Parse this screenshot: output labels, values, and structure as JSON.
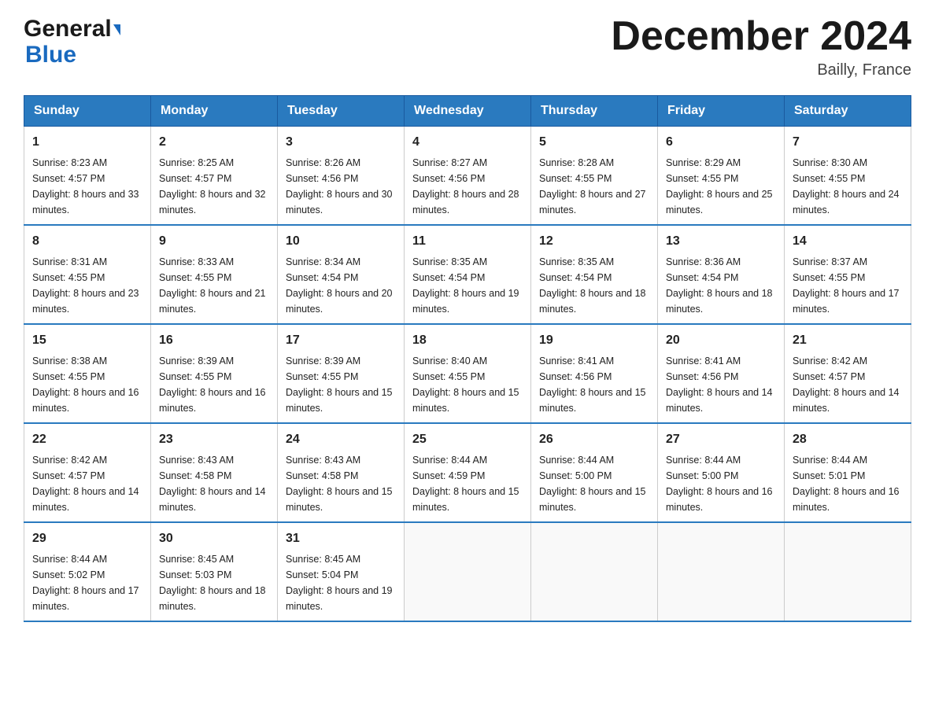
{
  "header": {
    "logo_general": "General",
    "logo_blue": "Blue",
    "month_title": "December 2024",
    "location": "Bailly, France"
  },
  "days_of_week": [
    "Sunday",
    "Monday",
    "Tuesday",
    "Wednesday",
    "Thursday",
    "Friday",
    "Saturday"
  ],
  "weeks": [
    [
      {
        "day": "1",
        "sunrise": "8:23 AM",
        "sunset": "4:57 PM",
        "daylight": "8 hours and 33 minutes."
      },
      {
        "day": "2",
        "sunrise": "8:25 AM",
        "sunset": "4:57 PM",
        "daylight": "8 hours and 32 minutes."
      },
      {
        "day": "3",
        "sunrise": "8:26 AM",
        "sunset": "4:56 PM",
        "daylight": "8 hours and 30 minutes."
      },
      {
        "day": "4",
        "sunrise": "8:27 AM",
        "sunset": "4:56 PM",
        "daylight": "8 hours and 28 minutes."
      },
      {
        "day": "5",
        "sunrise": "8:28 AM",
        "sunset": "4:55 PM",
        "daylight": "8 hours and 27 minutes."
      },
      {
        "day": "6",
        "sunrise": "8:29 AM",
        "sunset": "4:55 PM",
        "daylight": "8 hours and 25 minutes."
      },
      {
        "day": "7",
        "sunrise": "8:30 AM",
        "sunset": "4:55 PM",
        "daylight": "8 hours and 24 minutes."
      }
    ],
    [
      {
        "day": "8",
        "sunrise": "8:31 AM",
        "sunset": "4:55 PM",
        "daylight": "8 hours and 23 minutes."
      },
      {
        "day": "9",
        "sunrise": "8:33 AM",
        "sunset": "4:55 PM",
        "daylight": "8 hours and 21 minutes."
      },
      {
        "day": "10",
        "sunrise": "8:34 AM",
        "sunset": "4:54 PM",
        "daylight": "8 hours and 20 minutes."
      },
      {
        "day": "11",
        "sunrise": "8:35 AM",
        "sunset": "4:54 PM",
        "daylight": "8 hours and 19 minutes."
      },
      {
        "day": "12",
        "sunrise": "8:35 AM",
        "sunset": "4:54 PM",
        "daylight": "8 hours and 18 minutes."
      },
      {
        "day": "13",
        "sunrise": "8:36 AM",
        "sunset": "4:54 PM",
        "daylight": "8 hours and 18 minutes."
      },
      {
        "day": "14",
        "sunrise": "8:37 AM",
        "sunset": "4:55 PM",
        "daylight": "8 hours and 17 minutes."
      }
    ],
    [
      {
        "day": "15",
        "sunrise": "8:38 AM",
        "sunset": "4:55 PM",
        "daylight": "8 hours and 16 minutes."
      },
      {
        "day": "16",
        "sunrise": "8:39 AM",
        "sunset": "4:55 PM",
        "daylight": "8 hours and 16 minutes."
      },
      {
        "day": "17",
        "sunrise": "8:39 AM",
        "sunset": "4:55 PM",
        "daylight": "8 hours and 15 minutes."
      },
      {
        "day": "18",
        "sunrise": "8:40 AM",
        "sunset": "4:55 PM",
        "daylight": "8 hours and 15 minutes."
      },
      {
        "day": "19",
        "sunrise": "8:41 AM",
        "sunset": "4:56 PM",
        "daylight": "8 hours and 15 minutes."
      },
      {
        "day": "20",
        "sunrise": "8:41 AM",
        "sunset": "4:56 PM",
        "daylight": "8 hours and 14 minutes."
      },
      {
        "day": "21",
        "sunrise": "8:42 AM",
        "sunset": "4:57 PM",
        "daylight": "8 hours and 14 minutes."
      }
    ],
    [
      {
        "day": "22",
        "sunrise": "8:42 AM",
        "sunset": "4:57 PM",
        "daylight": "8 hours and 14 minutes."
      },
      {
        "day": "23",
        "sunrise": "8:43 AM",
        "sunset": "4:58 PM",
        "daylight": "8 hours and 14 minutes."
      },
      {
        "day": "24",
        "sunrise": "8:43 AM",
        "sunset": "4:58 PM",
        "daylight": "8 hours and 15 minutes."
      },
      {
        "day": "25",
        "sunrise": "8:44 AM",
        "sunset": "4:59 PM",
        "daylight": "8 hours and 15 minutes."
      },
      {
        "day": "26",
        "sunrise": "8:44 AM",
        "sunset": "5:00 PM",
        "daylight": "8 hours and 15 minutes."
      },
      {
        "day": "27",
        "sunrise": "8:44 AM",
        "sunset": "5:00 PM",
        "daylight": "8 hours and 16 minutes."
      },
      {
        "day": "28",
        "sunrise": "8:44 AM",
        "sunset": "5:01 PM",
        "daylight": "8 hours and 16 minutes."
      }
    ],
    [
      {
        "day": "29",
        "sunrise": "8:44 AM",
        "sunset": "5:02 PM",
        "daylight": "8 hours and 17 minutes."
      },
      {
        "day": "30",
        "sunrise": "8:45 AM",
        "sunset": "5:03 PM",
        "daylight": "8 hours and 18 minutes."
      },
      {
        "day": "31",
        "sunrise": "8:45 AM",
        "sunset": "5:04 PM",
        "daylight": "8 hours and 19 minutes."
      },
      null,
      null,
      null,
      null
    ]
  ]
}
